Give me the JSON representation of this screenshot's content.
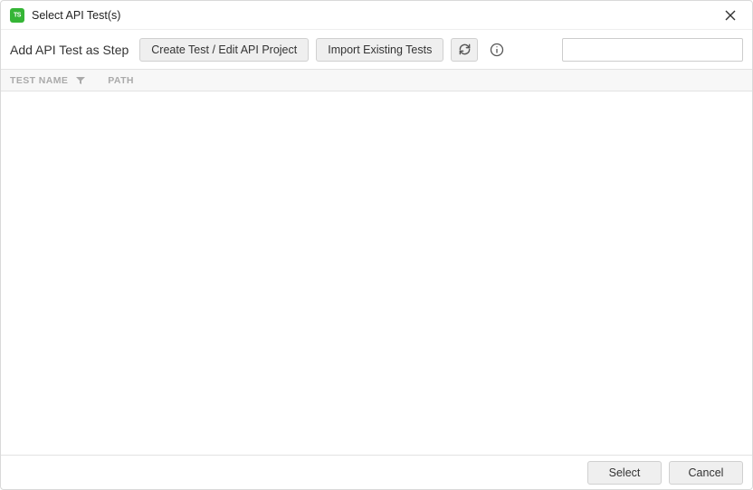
{
  "dialog": {
    "title": "Select API Test(s)"
  },
  "toolbar": {
    "heading": "Add API Test as Step",
    "create_button": "Create Test / Edit API Project",
    "import_button": "Import Existing Tests",
    "search_value": ""
  },
  "table": {
    "columns": {
      "test_name": "TEST NAME",
      "path": "PATH"
    },
    "rows": []
  },
  "footer": {
    "select": "Select",
    "cancel": "Cancel"
  }
}
